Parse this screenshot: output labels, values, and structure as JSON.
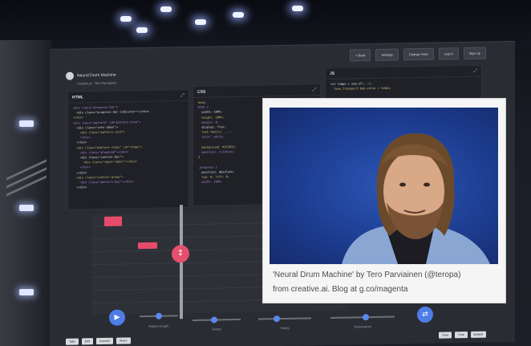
{
  "app": {
    "title": "Neural Drum Machine",
    "subtitle": "creative.ai · Tero Parviainen"
  },
  "toolbar": {
    "buttons": [
      "< Back",
      "Settings",
      "Change View",
      "Log In",
      "Sign Up"
    ]
  },
  "panels": {
    "html": {
      "title": "HTML",
      "lines": [
        "<div class=\"progress-bar\">",
        "  <div class=\"progress-bar-indicator\"></div>",
        "</div>",
        "<div class=\"pattern\" id=\"pattern-area\">",
        "  <div class=\"info-label\">",
        "    <div class=\"pattern-card\">",
        "    </div>",
        "  </div>",
        "  <div class=\"pattern-steps\" id=\"steps\">",
        "    <div class=\"playhead\"></div>",
        "    <div class=\"control-bar\">",
        "      <div class=\"input-label\"></div>",
        "    </div>",
        "  </div>",
        "  <div class=\"control-group\">",
        "    <div class=\"pattern-box\"></div>",
        "  </div>"
      ]
    },
    "css": {
      "title": "CSS",
      "lines": [
        "body,",
        "html {",
        "  width: 100%;",
        "  height: 100%;",
        "  margin: 0;",
        "  display: flex;",
        "  font-family: ...;",
        "  color: white;",
        "",
        "  background: #1f2022;",
        "  position: relative;",
        "}",
        "",
        ".progress {",
        "  position: absolute;",
        "  top: 0; left: 0;",
        "  width: 100%;"
      ]
    },
    "js": {
      "title": "JS",
      "lines": [
        "let tempo = seq.of(...);",
        "  Tone.Transport.bpm.value = tempo;",
        "",
        "  ...",
        "",
        "function updatePattern() {",
        "  ..."
      ]
    }
  },
  "controls": {
    "sliders": [
      {
        "label": "Pattern length",
        "value": 0.5
      },
      {
        "label": "Tempo",
        "value": 0.45
      },
      {
        "label": "Swing",
        "value": 0.35
      },
      {
        "label": "Temperature",
        "value": 0.55
      }
    ],
    "play_button_icon": "play-icon",
    "regenerate_icon": "shuffle-icon"
  },
  "footer": {
    "left_buttons": [
      "Tabs",
      "Edit",
      "Console",
      "Share"
    ],
    "right_buttons": [
      "Save",
      "Fork",
      "Embed"
    ]
  },
  "overlay": {
    "line1": "'Neural Drum Machine' by Tero Parviainen (@teropa)",
    "line2": "from creative.ai. Blog at g.co/magenta"
  },
  "colors": {
    "accent_pink": "#e64c6a",
    "accent_blue": "#5a88ee",
    "editor_bg": "#1f2127",
    "photo_bg": "#2b57b6"
  }
}
